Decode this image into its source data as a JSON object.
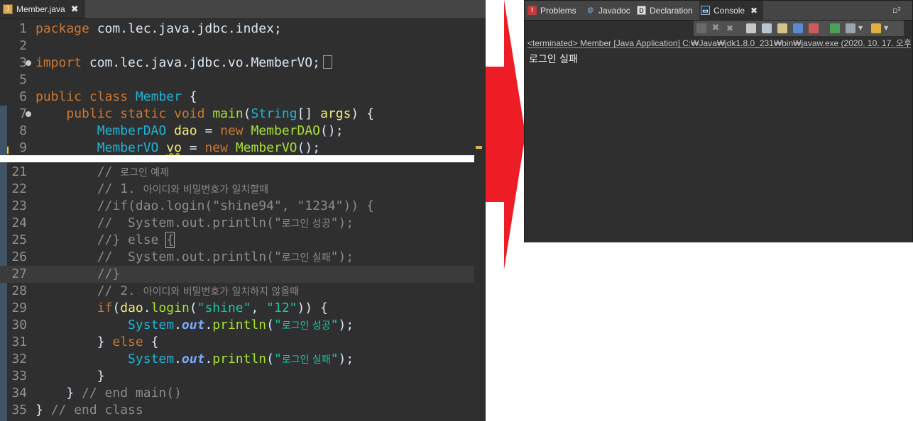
{
  "editor": {
    "tab_label": "Member.java",
    "tab_close": "✖",
    "top_lines": [
      {
        "no": "1",
        "tokens": [
          {
            "t": "package",
            "c": "kw"
          },
          {
            "t": " com.lec.java.jdbc.index;",
            "c": "tx"
          }
        ]
      },
      {
        "no": "2",
        "tokens": []
      },
      {
        "no": "3",
        "fold": true,
        "tokens": [
          {
            "t": "import",
            "c": "kw"
          },
          {
            "t": " com.lec.java.jdbc.vo.MemberVO;",
            "c": "tx"
          }
        ],
        "folded_box": true
      },
      {
        "no": "5",
        "tokens": []
      },
      {
        "no": "6",
        "tokens": [
          {
            "t": "public",
            "c": "kw"
          },
          {
            "t": " ",
            "c": "tx"
          },
          {
            "t": "class",
            "c": "kw"
          },
          {
            "t": " ",
            "c": "tx"
          },
          {
            "t": "Member",
            "c": "ty"
          },
          {
            "t": " {",
            "c": "tx"
          }
        ]
      },
      {
        "no": "7",
        "fold": true,
        "tokens": [
          {
            "t": "    ",
            "c": "tx"
          },
          {
            "t": "public",
            "c": "kw"
          },
          {
            "t": " ",
            "c": "tx"
          },
          {
            "t": "static",
            "c": "kw"
          },
          {
            "t": " ",
            "c": "tx"
          },
          {
            "t": "void",
            "c": "kw"
          },
          {
            "t": " ",
            "c": "tx"
          },
          {
            "t": "main",
            "c": "fn"
          },
          {
            "t": "(",
            "c": "tx"
          },
          {
            "t": "String",
            "c": "ty"
          },
          {
            "t": "[] ",
            "c": "tx"
          },
          {
            "t": "args",
            "c": "vr"
          },
          {
            "t": ") {",
            "c": "tx"
          }
        ]
      },
      {
        "no": "8",
        "tokens": [
          {
            "t": "        ",
            "c": "tx"
          },
          {
            "t": "MemberDAO",
            "c": "ty"
          },
          {
            "t": " ",
            "c": "tx"
          },
          {
            "t": "dao",
            "c": "vr"
          },
          {
            "t": " = ",
            "c": "tx"
          },
          {
            "t": "new",
            "c": "kw"
          },
          {
            "t": " ",
            "c": "tx"
          },
          {
            "t": "MemberDAO",
            "c": "fn"
          },
          {
            "t": "();",
            "c": "tx"
          }
        ]
      },
      {
        "no": "9",
        "warn": true,
        "tokens": [
          {
            "t": "        ",
            "c": "tx"
          },
          {
            "t": "MemberVO",
            "c": "ty"
          },
          {
            "t": " ",
            "c": "tx"
          },
          {
            "t": "vo",
            "c": "vr warnu"
          },
          {
            "t": " = ",
            "c": "tx"
          },
          {
            "t": "new",
            "c": "kw"
          },
          {
            "t": " ",
            "c": "tx"
          },
          {
            "t": "MemberVO",
            "c": "fn"
          },
          {
            "t": "();",
            "c": "tx"
          }
        ]
      }
    ],
    "bottom_lines": [
      {
        "no": "21",
        "tokens": [
          {
            "t": "        // ",
            "c": "cm"
          },
          {
            "t": "로그인 예제",
            "c": "cm kr"
          }
        ]
      },
      {
        "no": "22",
        "tokens": [
          {
            "t": "        // 1. ",
            "c": "cm"
          },
          {
            "t": "아이디와 비밀번호가 일치할때",
            "c": "cm kr"
          }
        ]
      },
      {
        "no": "23",
        "tokens": [
          {
            "t": "        //if(dao.login(\"shine94\", \"1234\")) {",
            "c": "cm"
          }
        ]
      },
      {
        "no": "24",
        "tokens": [
          {
            "t": "        //  System.out.println(\"",
            "c": "cm"
          },
          {
            "t": "로그인 성공",
            "c": "cm kr"
          },
          {
            "t": "\");",
            "c": "cm"
          }
        ]
      },
      {
        "no": "25",
        "tokens": [
          {
            "t": "        //} else ",
            "c": "cm"
          },
          {
            "t": "{",
            "c": "cm boxed"
          }
        ]
      },
      {
        "no": "26",
        "tokens": [
          {
            "t": "        //  System.out.println(\"",
            "c": "cm"
          },
          {
            "t": "로그인 실패",
            "c": "cm kr"
          },
          {
            "t": "\");",
            "c": "cm"
          }
        ]
      },
      {
        "no": "27",
        "current": true,
        "tokens": [
          {
            "t": "        //}",
            "c": "cm"
          }
        ]
      },
      {
        "no": "28",
        "tokens": [
          {
            "t": "        // 2. ",
            "c": "cm"
          },
          {
            "t": "아이디와 비밀번호가 일치하지 않을때",
            "c": "cm kr"
          }
        ]
      },
      {
        "no": "29",
        "tokens": [
          {
            "t": "        ",
            "c": "tx"
          },
          {
            "t": "if",
            "c": "kw"
          },
          {
            "t": "(",
            "c": "tx"
          },
          {
            "t": "dao",
            "c": "vr"
          },
          {
            "t": ".",
            "c": "tx"
          },
          {
            "t": "login",
            "c": "fn"
          },
          {
            "t": "(",
            "c": "tx"
          },
          {
            "t": "\"shine\"",
            "c": "st"
          },
          {
            "t": ", ",
            "c": "tx"
          },
          {
            "t": "\"12\"",
            "c": "st"
          },
          {
            "t": ")) {",
            "c": "tx"
          }
        ]
      },
      {
        "no": "30",
        "tokens": [
          {
            "t": "            ",
            "c": "tx"
          },
          {
            "t": "System",
            "c": "ty"
          },
          {
            "t": ".",
            "c": "tx"
          },
          {
            "t": "out",
            "c": "sf"
          },
          {
            "t": ".",
            "c": "tx"
          },
          {
            "t": "println",
            "c": "fn"
          },
          {
            "t": "(",
            "c": "tx"
          },
          {
            "t": "\"",
            "c": "st"
          },
          {
            "t": "로그인 성공",
            "c": "st kr"
          },
          {
            "t": "\"",
            "c": "st"
          },
          {
            "t": ");",
            "c": "tx"
          }
        ]
      },
      {
        "no": "31",
        "tokens": [
          {
            "t": "        } ",
            "c": "tx"
          },
          {
            "t": "else",
            "c": "kw"
          },
          {
            "t": " {",
            "c": "tx"
          }
        ]
      },
      {
        "no": "32",
        "tokens": [
          {
            "t": "            ",
            "c": "tx"
          },
          {
            "t": "System",
            "c": "ty"
          },
          {
            "t": ".",
            "c": "tx"
          },
          {
            "t": "out",
            "c": "sf"
          },
          {
            "t": ".",
            "c": "tx"
          },
          {
            "t": "println",
            "c": "fn"
          },
          {
            "t": "(",
            "c": "tx"
          },
          {
            "t": "\"",
            "c": "st"
          },
          {
            "t": "로그인 실패",
            "c": "st kr"
          },
          {
            "t": "\"",
            "c": "st"
          },
          {
            "t": ");",
            "c": "tx"
          }
        ]
      },
      {
        "no": "33",
        "tokens": [
          {
            "t": "        }",
            "c": "tx"
          }
        ]
      },
      {
        "no": "34",
        "tokens": [
          {
            "t": "    } ",
            "c": "tx"
          },
          {
            "t": "// end main()",
            "c": "cm"
          }
        ]
      },
      {
        "no": "35",
        "tokens": [
          {
            "t": "} ",
            "c": "tx"
          },
          {
            "t": "// end class",
            "c": "cm"
          }
        ]
      }
    ]
  },
  "console_view": {
    "tabs": [
      {
        "label": "Problems",
        "icon": "problems-icon"
      },
      {
        "label": "Javadoc",
        "icon": "javadoc-icon"
      },
      {
        "label": "Declaration",
        "icon": "declaration-icon"
      },
      {
        "label": "Console",
        "icon": "console-icon",
        "active": true
      }
    ],
    "tab_close": "✖",
    "maximize": "▫²",
    "status": "<terminated> Member [Java Application] C:₩Java₩jdk1.8.0_231₩bin₩javaw.exe (2020. 10. 17. 오후",
    "output": "로그인 실패"
  },
  "colors": {
    "editor_bg": "#2f2f2f",
    "arrow": "#ee1c24",
    "keyword": "#cc7832",
    "type": "#1eb4d8",
    "method": "#a6e22e",
    "variable": "#f3ec79",
    "string": "#17c6a3",
    "comment": "#8a8a8a"
  }
}
